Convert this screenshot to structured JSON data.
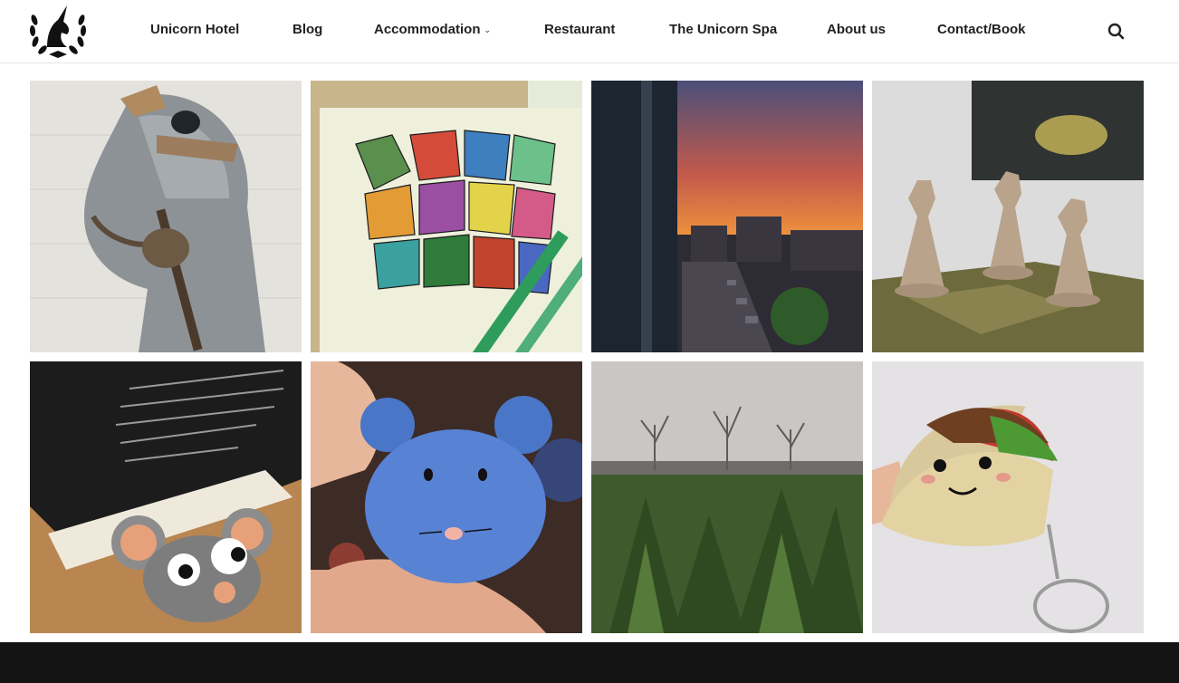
{
  "brand": {
    "logo_icon": "unicorn-laurel-logo"
  },
  "nav": {
    "items": [
      {
        "label": "Unicorn Hotel"
      },
      {
        "label": "Blog"
      },
      {
        "label": "Accommodation",
        "has_dropdown": true
      },
      {
        "label": "Restaurant"
      },
      {
        "label": "The Unicorn Spa"
      },
      {
        "label": "About us"
      },
      {
        "label": "Contact/Book"
      }
    ],
    "search_icon": "search-icon"
  },
  "gallery": {
    "images": [
      {
        "subject": "wooden-rocking-horse-head"
      },
      {
        "subject": "geometric-colored-drawing-with-markers"
      },
      {
        "subject": "sunset-over-street-from-window"
      },
      {
        "subject": "board-game-miniature-figures"
      },
      {
        "subject": "crochet-mouse-on-book"
      },
      {
        "subject": "blue-crochet-mouse-in-hand"
      },
      {
        "subject": "christmas-tree-field"
      },
      {
        "subject": "crochet-taco-keychain"
      }
    ]
  },
  "colors": {
    "footer_bg": "#141414",
    "header_border": "#e6e6e6",
    "nav_text": "#222222"
  }
}
